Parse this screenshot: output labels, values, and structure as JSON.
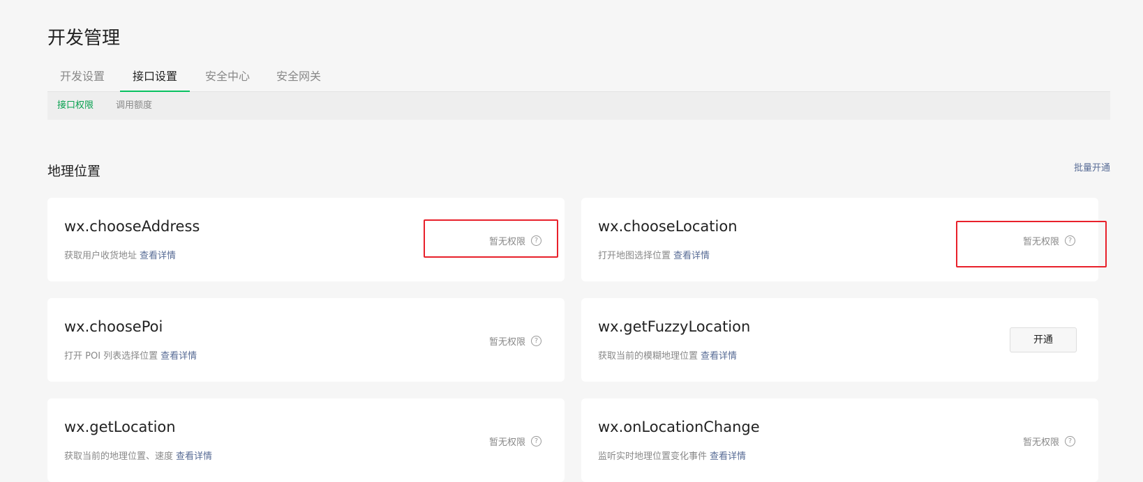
{
  "page": {
    "title": "开发管理"
  },
  "tabs": [
    {
      "label": "开发设置"
    },
    {
      "label": "接口设置"
    },
    {
      "label": "安全中心"
    },
    {
      "label": "安全网关"
    }
  ],
  "subnav": [
    {
      "label": "接口权限"
    },
    {
      "label": "调用额度"
    }
  ],
  "section": {
    "title": "地理位置",
    "batch_label": "批量开通"
  },
  "cards": [
    {
      "name": "wx.chooseAddress",
      "desc": "获取用户收货地址",
      "link": "查看详情",
      "status": "暂无权限",
      "help": "?"
    },
    {
      "name": "wx.chooseLocation",
      "desc": "打开地图选择位置",
      "link": "查看详情",
      "status": "暂无权限",
      "help": "?"
    },
    {
      "name": "wx.choosePoi",
      "desc": "打开 POI 列表选择位置",
      "link": "查看详情",
      "status": "暂无权限",
      "help": "?"
    },
    {
      "name": "wx.getFuzzyLocation",
      "desc": "获取当前的模糊地理位置",
      "link": "查看详情",
      "button": "开通"
    },
    {
      "name": "wx.getLocation",
      "desc": "获取当前的地理位置、速度",
      "link": "查看详情",
      "status": "暂无权限",
      "help": "?"
    },
    {
      "name": "wx.onLocationChange",
      "desc": "监听实时地理位置变化事件",
      "link": "查看详情",
      "status": "暂无权限",
      "help": "?"
    }
  ],
  "colors": {
    "accent": "#07c160",
    "link": "#576b95",
    "highlight": "#e8202a"
  }
}
